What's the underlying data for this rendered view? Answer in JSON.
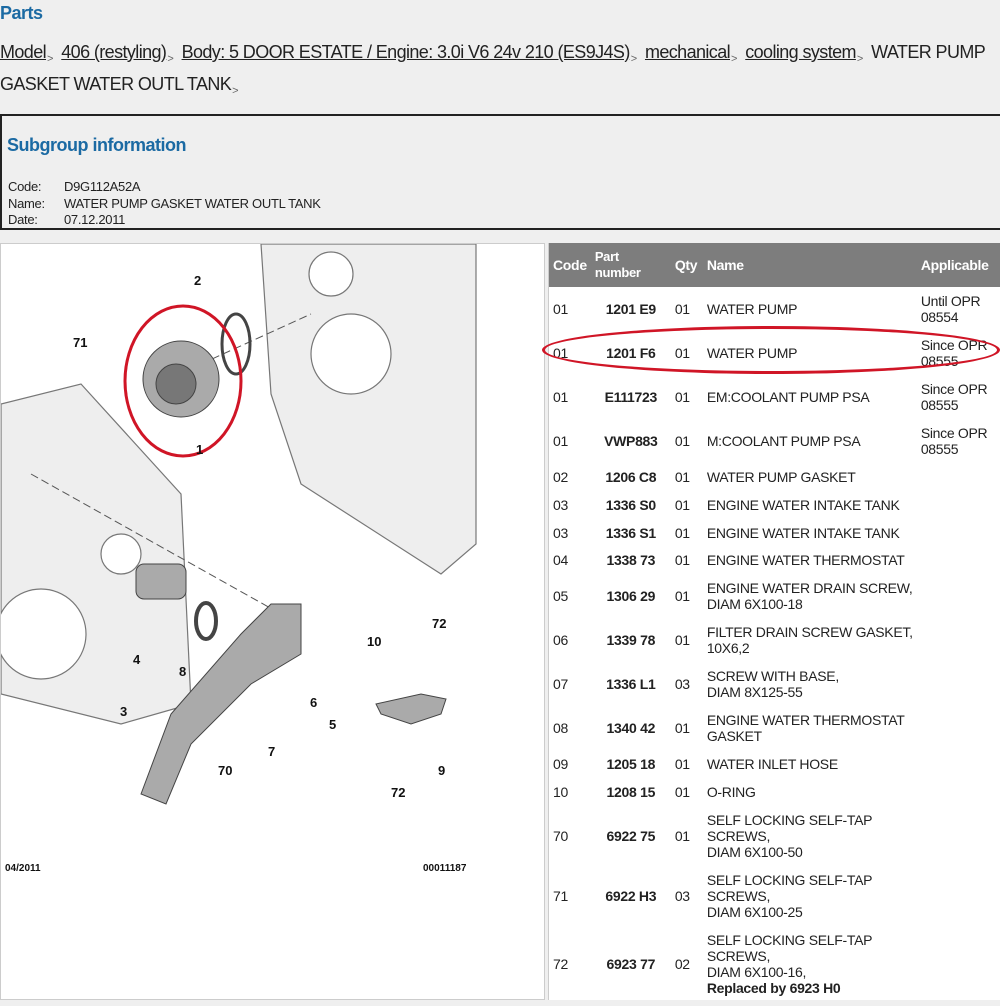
{
  "page": {
    "title": "Parts"
  },
  "breadcrumb": {
    "items": [
      "Model",
      "406 (restyling)",
      "Body: 5 DOOR ESTATE / Engine: 3.0i V6 24v 210 (ES9J4S)",
      "mechanical",
      "cooling system"
    ],
    "current_line1": "WATER PUMP",
    "current_line2": "GASKET WATER OUTL TANK"
  },
  "subgroup": {
    "heading": "Subgroup information",
    "code_label": "Code:",
    "code": "D9G112A52A",
    "name_label": "Name:",
    "name": "WATER PUMP GASKET WATER OUTL TANK",
    "date_label": "Date:",
    "date": "07.12.2011"
  },
  "diagram": {
    "labels": [
      "1",
      "2",
      "3",
      "4",
      "5",
      "6",
      "7",
      "8",
      "9",
      "10",
      "70",
      "71",
      "72",
      "72"
    ],
    "date": "04/2011",
    "ref": "00011187"
  },
  "highlight_color": "#d01526",
  "table": {
    "headers": {
      "code": "Code",
      "part": "Part number",
      "qty": "Qty",
      "name": "Name",
      "applicable": "Applicable"
    },
    "rows": [
      {
        "code": "01",
        "part": "1201 E9",
        "qty": "01",
        "name": "WATER PUMP",
        "applicable": "Until OPR 08554"
      },
      {
        "code": "01",
        "part": "1201 F6",
        "qty": "01",
        "name": "WATER PUMP",
        "applicable": "Since OPR 08555"
      },
      {
        "code": "01",
        "part": "E111723",
        "qty": "01",
        "name": "EM:COOLANT PUMP PSA",
        "applicable": "Since OPR 08555"
      },
      {
        "code": "01",
        "part": "VWP883",
        "qty": "01",
        "name": "M:COOLANT PUMP PSA",
        "applicable": "Since OPR 08555"
      },
      {
        "code": "02",
        "part": "1206 C8",
        "qty": "01",
        "name": "WATER PUMP GASKET",
        "applicable": ""
      },
      {
        "code": "03",
        "part": "1336 S0",
        "qty": "01",
        "name": "ENGINE WATER INTAKE TANK",
        "applicable": ""
      },
      {
        "code": "03",
        "part": "1336 S1",
        "qty": "01",
        "name": "ENGINE WATER INTAKE TANK",
        "applicable": ""
      },
      {
        "code": "04",
        "part": "1338 73",
        "qty": "01",
        "name": "ENGINE WATER THERMOSTAT",
        "applicable": ""
      },
      {
        "code": "05",
        "part": "1306 29",
        "qty": "01",
        "name": "ENGINE WATER DRAIN SCREW,\nDIAM 6X100-18",
        "applicable": ""
      },
      {
        "code": "06",
        "part": "1339 78",
        "qty": "01",
        "name": "FILTER DRAIN SCREW GASKET,\n10X6,2",
        "applicable": ""
      },
      {
        "code": "07",
        "part": "1336 L1",
        "qty": "03",
        "name": "SCREW WITH BASE,\nDIAM 8X125-55",
        "applicable": ""
      },
      {
        "code": "08",
        "part": "1340 42",
        "qty": "01",
        "name": "ENGINE WATER THERMOSTAT\nGASKET",
        "applicable": ""
      },
      {
        "code": "09",
        "part": "1205 18",
        "qty": "01",
        "name": "WATER INLET HOSE",
        "applicable": ""
      },
      {
        "code": "10",
        "part": "1208 15",
        "qty": "01",
        "name": "O-RING",
        "applicable": ""
      },
      {
        "code": "70",
        "part": "6922 75",
        "qty": "01",
        "name": "SELF LOCKING SELF-TAP\nSCREWS,\nDIAM 6X100-50",
        "applicable": ""
      },
      {
        "code": "71",
        "part": "6922 H3",
        "qty": "03",
        "name": "SELF LOCKING SELF-TAP\nSCREWS,\nDIAM 6X100-25",
        "applicable": ""
      },
      {
        "code": "72",
        "part": "6923 77",
        "qty": "02",
        "name": "SELF LOCKING SELF-TAP\nSCREWS,\nDIAM 6X100-16,",
        "applicable": "",
        "replaced": "Replaced by 6923 H0"
      }
    ]
  }
}
